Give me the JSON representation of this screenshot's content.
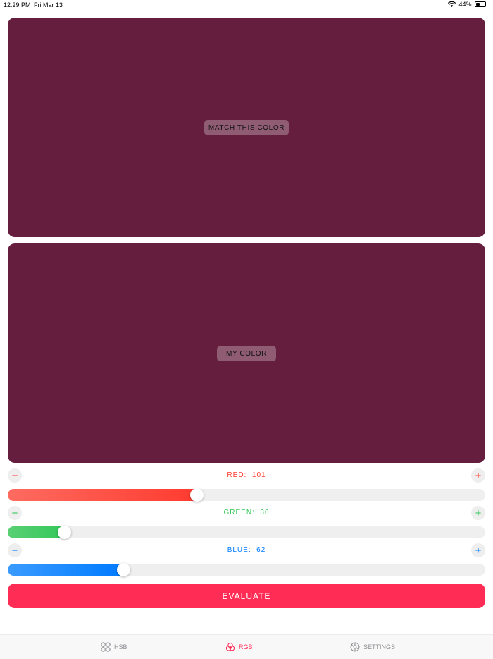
{
  "status_bar": {
    "time": "12:29 PM",
    "date": "Fri Mar 13",
    "battery": "44%",
    "battery_level": 0.44
  },
  "target_swatch": {
    "label": "MATCH THIS COLOR",
    "color": "#651e3e"
  },
  "my_swatch": {
    "label": "MY COLOR",
    "color": "#651e3e"
  },
  "sliders": [
    {
      "name": "RED",
      "label": "RED:",
      "value": "101",
      "fraction": 0.396,
      "color": "#ff3b30",
      "gradient_start": "#ff6b60"
    },
    {
      "name": "GREEN",
      "label": "GREEN:",
      "value": "30",
      "fraction": 0.118,
      "color": "#34c759",
      "gradient_start": "#5ad074"
    },
    {
      "name": "BLUE",
      "label": "BLUE:",
      "value": "62",
      "fraction": 0.243,
      "color": "#007aff",
      "gradient_start": "#3a9bff"
    }
  ],
  "controls": {
    "minus": "−",
    "plus": "+"
  },
  "evaluate": {
    "label": "EVALUATE",
    "color": "#ff2d55"
  },
  "tabs": [
    {
      "id": "hsb",
      "label": "HSB",
      "icon": "circles-grid-icon",
      "active": false
    },
    {
      "id": "rgb",
      "label": "RGB",
      "icon": "rgb-rings-icon",
      "active": true
    },
    {
      "id": "settings",
      "label": "SETTINGS",
      "icon": "gear-icon",
      "active": false
    }
  ],
  "colors": {
    "accent": "#ff2d55",
    "inactive_tab": "#8e8e93"
  }
}
